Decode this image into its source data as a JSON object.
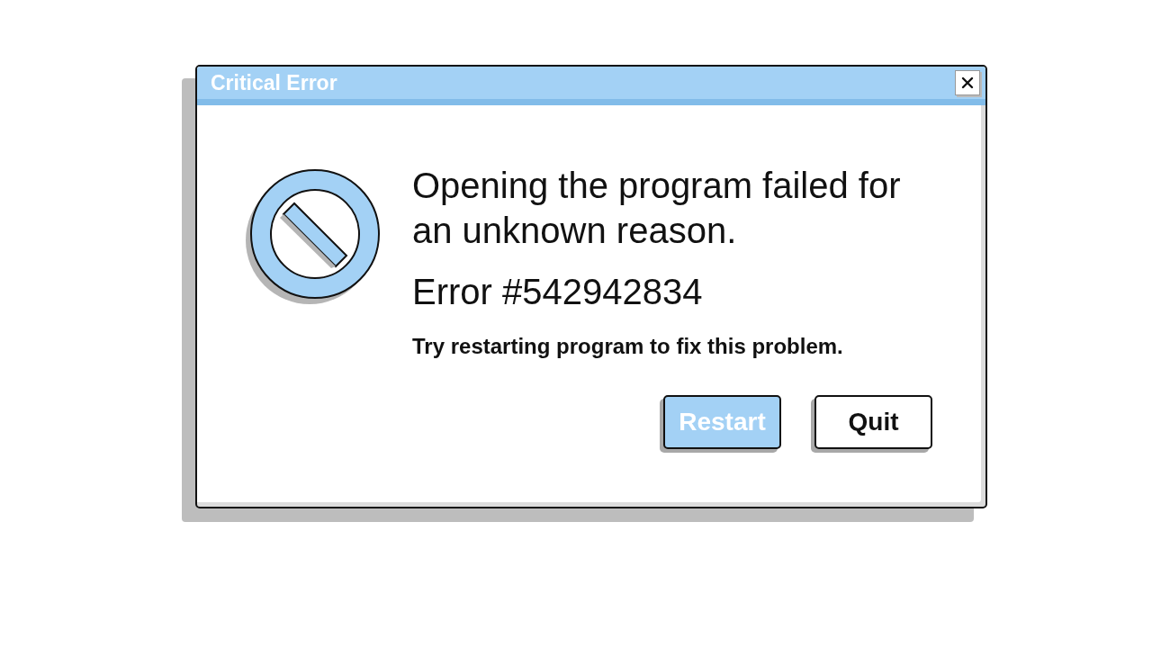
{
  "window": {
    "title": "Critical Error"
  },
  "message": {
    "heading": "Opening the program failed for an unknown reason.",
    "error_code": "Error #542942834",
    "hint": "Try restarting program to fix this problem."
  },
  "buttons": [
    {
      "label": "Restart",
      "kind": "primary"
    },
    {
      "label": "Quit",
      "kind": "secondary"
    }
  ]
}
